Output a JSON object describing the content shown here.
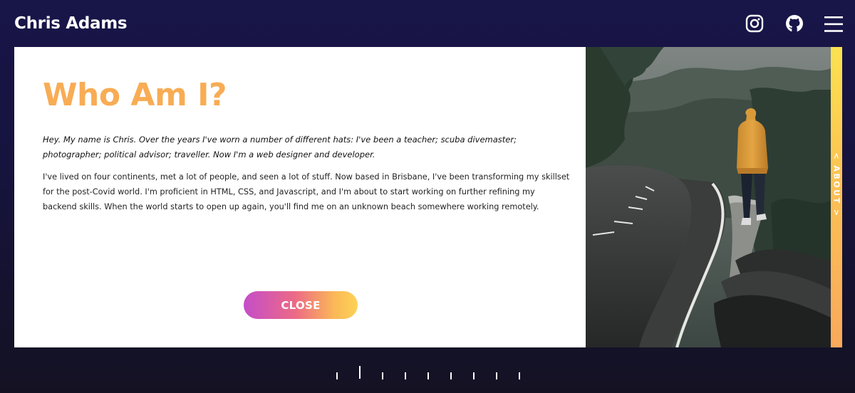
{
  "header": {
    "brand": "Chris Adams",
    "icons": [
      "instagram-icon",
      "github-icon",
      "hamburger-menu-icon"
    ]
  },
  "about": {
    "title": "Who Am I?",
    "intro": "Hey. My name is Chris. Over the years I've worn a number of different hats: I've been a teacher; scuba divemaster; photographer; political advisor; traveller. Now I'm a web designer and developer.",
    "bio": "I've lived on four continents, met a lot of people, and seen a lot of stuff. Now based in Brisbane, I've been transforming my skillset for the post-Covid world. I'm proficient in HTML, CSS, and Javascript, and I'm about to start working on further refining my backend skills. When the world starts to open up again, you'll find me on an unknown beach somewhere working remotely.",
    "close_label": "CLOSE"
  },
  "side_tab": {
    "label": "< ABOUT >"
  },
  "pager": {
    "slide_count": 9,
    "active_index": 1
  },
  "colors": {
    "background": "#181549",
    "title_accent": "#f8ac54",
    "button_gradient_start": "#c44dc9",
    "button_gradient_end": "#fdd256",
    "side_tab": "#fcc254"
  }
}
